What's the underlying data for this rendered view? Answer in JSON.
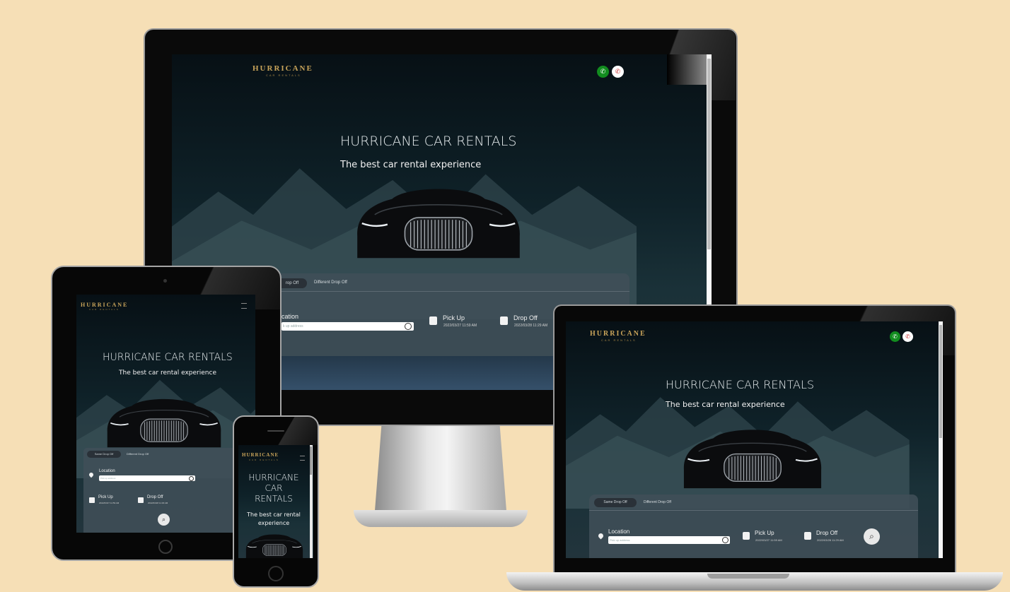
{
  "brand": {
    "name": "HURRICANE",
    "tagline": "CAR RENTALS"
  },
  "hero": {
    "title": "HURRICANE CAR RENTALS",
    "title_mobile": [
      "HURRICANE",
      "CAR",
      "RENTALS"
    ],
    "subtitle": "The best car rental experience",
    "subtitle_mobile": [
      "The best car rental",
      "experience"
    ]
  },
  "booking": {
    "tabs": [
      {
        "label": "Same Drop Off"
      },
      {
        "label": "Different Drop Off"
      }
    ],
    "desktop_tab_fragment": "rop Off",
    "location_label": "Location",
    "location_label_fragment": "cation",
    "location_placeholder": "Pick up address",
    "location_placeholder_fragment": "k up address",
    "pickup_label": "Pick Up",
    "pickup_value": "2022/03/27 11:59 AM",
    "dropoff_label": "Drop Off",
    "dropoff_value": "2022/03/28 11:29 AM"
  },
  "icons": {
    "whatsapp": "whatsapp-icon",
    "phone": "phone-icon",
    "menu": "hamburger-menu-icon",
    "location": "map-pin-icon",
    "calendar": "calendar-icon",
    "search": "search-icon",
    "gps": "gps-target-icon"
  },
  "colors": {
    "background": "#f6dfb6",
    "brand_gold": "#c9a45a",
    "whatsapp_green": "#128c1f"
  }
}
